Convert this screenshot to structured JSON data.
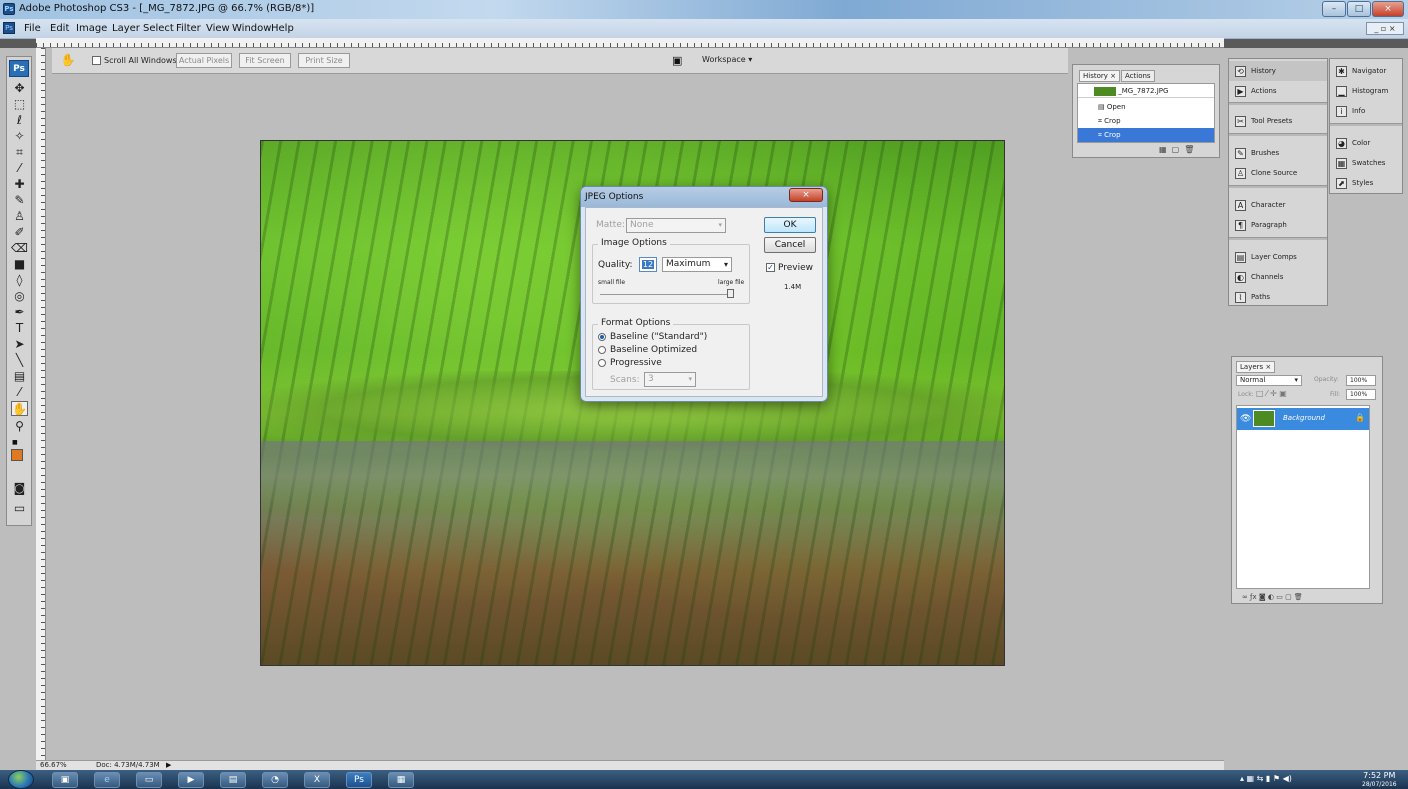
{
  "titlebar": {
    "title": "Adobe Photoshop CS3 - [_MG_7872.JPG @ 66.7% (RGB/8*)]",
    "minimize": "–",
    "maximize": "□",
    "close": "×"
  },
  "menubar": {
    "items": [
      "File",
      "Edit",
      "Image",
      "Layer",
      "Select",
      "Filter",
      "View",
      "Window",
      "Help"
    ],
    "doc_controls": "_ ▫ ×"
  },
  "options": {
    "scroll_all": "Scroll All Windows",
    "actual_pixels": "Actual Pixels",
    "fit_screen": "Fit Screen",
    "print_size": "Print Size",
    "workspace": "Workspace ▾"
  },
  "dialog": {
    "title": "JPEG Options",
    "matte_label": "Matte:",
    "matte_value": "None",
    "image_options": "Image Options",
    "quality_label": "Quality:",
    "quality_value": "12",
    "quality_preset": "Maximum",
    "small_file": "small file",
    "large_file": "large file",
    "format_options": "Format Options",
    "baseline_standard": "Baseline (\"Standard\")",
    "baseline_optimized": "Baseline Optimized",
    "progressive": "Progressive",
    "scans_label": "Scans:",
    "scans_value": "3",
    "ok": "OK",
    "cancel": "Cancel",
    "preview": "Preview",
    "size": "1.4M"
  },
  "history_panel": {
    "tabs": [
      "History ×",
      "Actions"
    ],
    "snapshot": "_MG_7872.JPG",
    "items": [
      "Open",
      "Crop",
      "Crop"
    ]
  },
  "dock_left": [
    "History",
    "Actions",
    "Tool Presets",
    "Brushes",
    "Clone Source",
    "Character",
    "Paragraph",
    "Layer Comps",
    "Channels",
    "Paths"
  ],
  "dock_right": [
    "Navigator",
    "Histogram",
    "Info",
    "Color",
    "Swatches",
    "Styles"
  ],
  "layers_panel": {
    "tab": "Layers ×",
    "blend": "Normal",
    "opacity_label": "Opacity:",
    "opacity": "100%",
    "lock_label": "Lock:",
    "fill_label": "Fill:",
    "fill": "100%",
    "layer_name": "Background"
  },
  "status": {
    "zoom": "66.67%",
    "doc": "Doc: 4.73M/4.73M"
  },
  "taskbar": {
    "time": "7:52 PM",
    "date": "28/07/2016"
  }
}
